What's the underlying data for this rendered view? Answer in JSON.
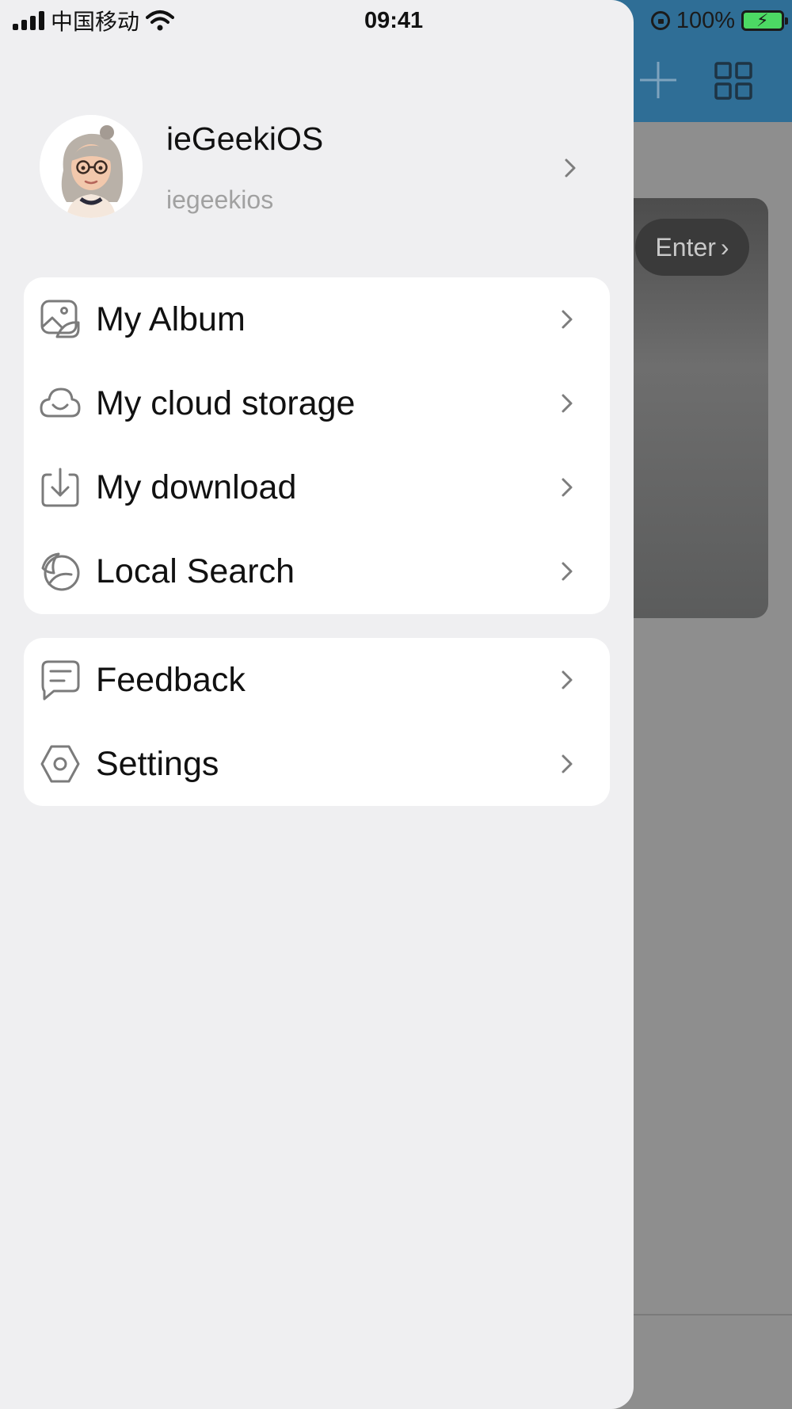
{
  "status_bar": {
    "carrier": "中国移动",
    "time": "09:41",
    "battery_percent": "100%"
  },
  "background_app": {
    "enter_label": "Enter",
    "header_color": "#2f6e96"
  },
  "profile": {
    "name": "ieGeekiOS",
    "username": "iegeekios"
  },
  "menu_primary": [
    {
      "label": "My Album",
      "icon": "album-icon"
    },
    {
      "label": "My cloud storage",
      "icon": "cloud-icon"
    },
    {
      "label": "My download",
      "icon": "download-icon"
    },
    {
      "label": "Local Search",
      "icon": "local-search-icon"
    }
  ],
  "menu_secondary": [
    {
      "label": "Feedback",
      "icon": "feedback-icon"
    },
    {
      "label": "Settings",
      "icon": "settings-icon"
    }
  ]
}
